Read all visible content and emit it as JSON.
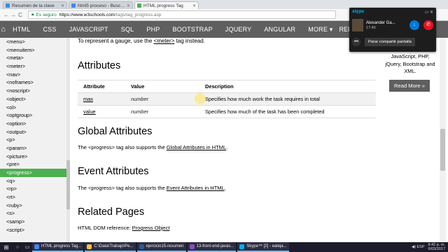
{
  "browser": {
    "tabs": [
      {
        "title": "Resumen de la clase",
        "favicon_color": "#3c8dde",
        "active": false
      },
      {
        "title": "html5 proceso - Buscar c",
        "favicon_color": "#4285f4",
        "active": false
      },
      {
        "title": "HTML progress Tag",
        "favicon_color": "#4caf50",
        "active": true
      }
    ],
    "nav": {
      "back": "←",
      "forward": "→",
      "reload": "C"
    },
    "address": {
      "secure_label": "Es seguro",
      "host": "https://www.w3schools.com",
      "path": "/tags/tag_progress.asp"
    }
  },
  "topnav": {
    "home_icon": "home-icon",
    "items": [
      "HTML",
      "CSS",
      "JAVASCRIPT",
      "SQL",
      "PHP",
      "BOOTSTRAP",
      "JQUERY",
      "ANGULAR",
      "MORE ▾"
    ],
    "references": "REFERENCE"
  },
  "sidebar": {
    "items": [
      "<menu>",
      "<menuitem>",
      "<meta>",
      "<meter>",
      "<nav>",
      "<noframes>",
      "<noscript>",
      "<object>",
      "<ol>",
      "<optgroup>",
      "<option>",
      "<output>",
      "<p>",
      "<param>",
      "<picture>",
      "<pre>",
      "<progress>",
      "<q>",
      "<rp>",
      "<rt>",
      "<ruby>",
      "<s>",
      "<samp>",
      "<script>"
    ],
    "active_index": 16
  },
  "main": {
    "gauge_text_pre": "To represent a gauge, use the ",
    "gauge_link": "<meter>",
    "gauge_text_post": " tag instead.",
    "attributes_heading": "Attributes",
    "table": {
      "headers": [
        "Attribute",
        "Value",
        "Description"
      ],
      "rows": [
        {
          "attribute": "max",
          "value": "number",
          "description": "Specifies how much work the task requires in total"
        },
        {
          "attribute": "value",
          "value": "number",
          "description": "Specifies how much of the task has been completed"
        }
      ]
    },
    "global_heading": "Global Attributes",
    "global_text_pre": "The <progress> tag also supports the ",
    "global_link": "Global Attributes in HTML",
    "global_text_post": ".",
    "event_heading": "Event Attributes",
    "event_text_pre": "The <progress> tag also supports the ",
    "event_link": "Event Attributes in HTML",
    "event_text_post": ".",
    "related_heading": "Related Pages",
    "related_text": "HTML DOM reference: ",
    "related_link": "Progress Object"
  },
  "right": {
    "ad_lines": [
      "JavaScript, PHP,",
      "jQuery, Bootstrap and",
      "XML."
    ],
    "read_more": "Read More »"
  },
  "skype": {
    "logo": "skype",
    "caller": "Alexander Ga...",
    "duration": "17:46",
    "share_button": "Parar compartir pantalla"
  },
  "taskbar": {
    "apps": [
      {
        "label": "HTML progress Tag...",
        "color": "#4285f4"
      },
      {
        "label": "C:\\Data\\Trabajo\\Pe...",
        "color": "#f4c542"
      },
      {
        "label": "ejercicio15-resumen",
        "color": "#2b579a"
      },
      {
        "label": "13-front-end-javas...",
        "color": "#8a4fbd"
      },
      {
        "label": "Skype™ [2] - ealeja...",
        "color": "#00aff0"
      }
    ],
    "lang": "ESP",
    "time": "8:42 p. m.",
    "date": "6/03/2017"
  }
}
